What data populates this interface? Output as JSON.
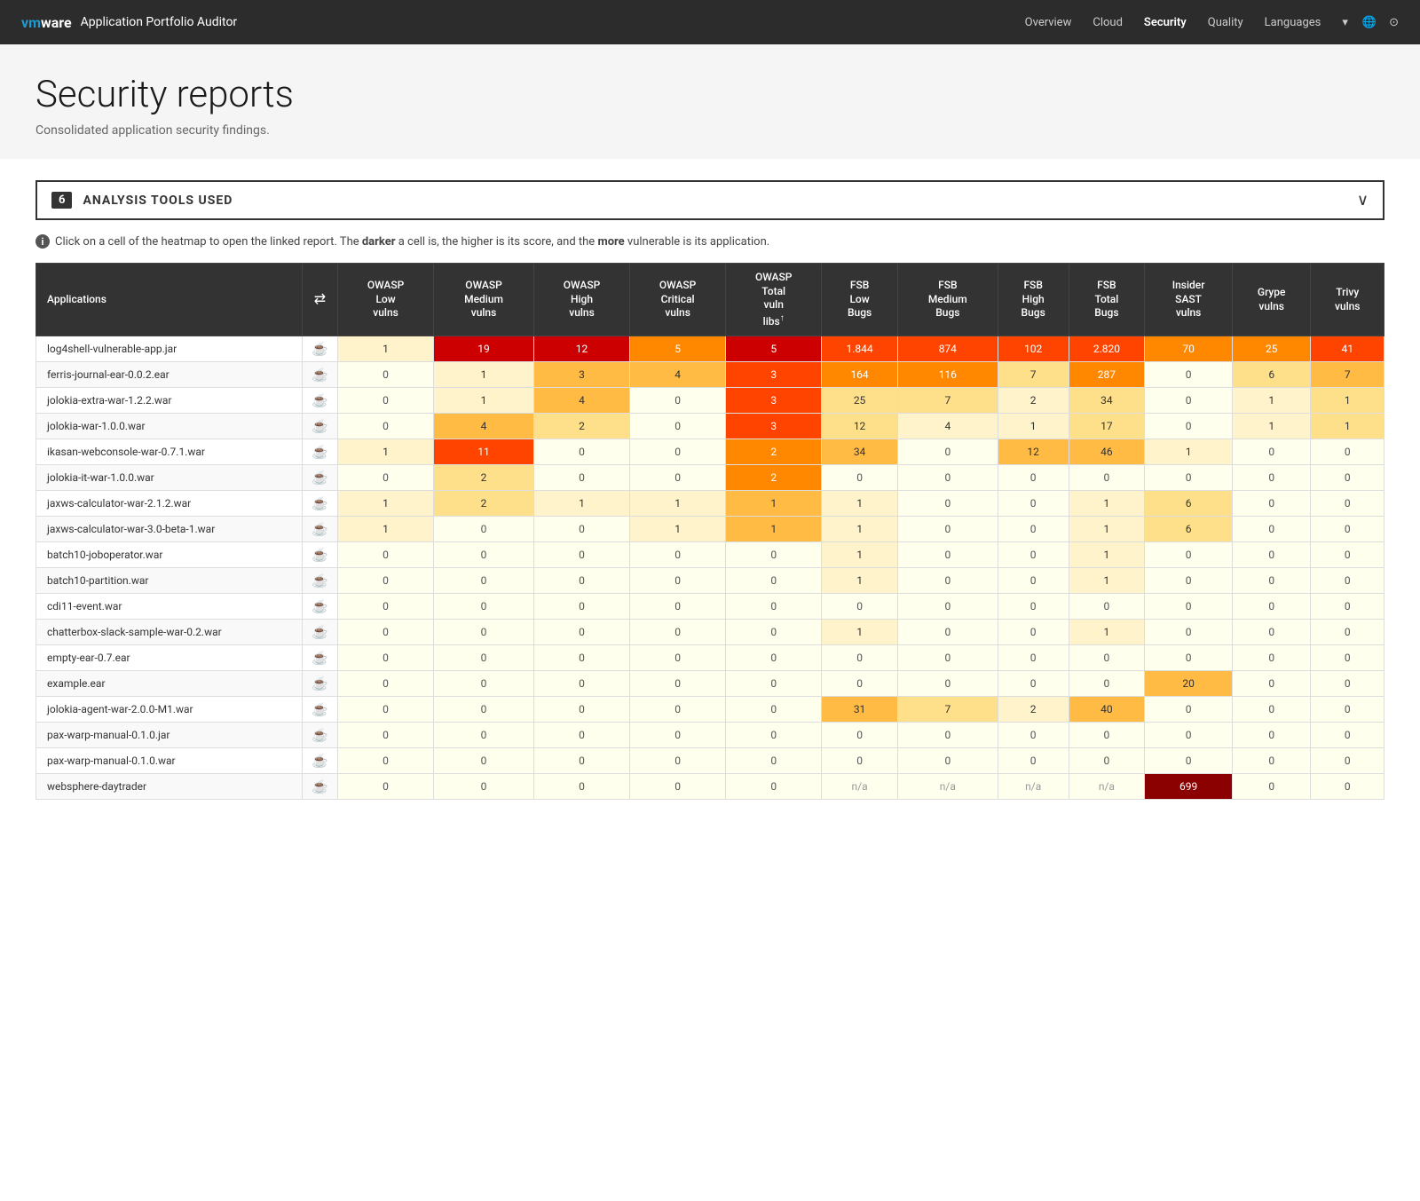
{
  "header": {
    "logo": "vm",
    "logo_colored": "ware",
    "app_name": "Application Portfolio Auditor",
    "nav": [
      {
        "label": "Overview",
        "active": false
      },
      {
        "label": "Cloud",
        "active": false
      },
      {
        "label": "Security",
        "active": true
      },
      {
        "label": "Quality",
        "active": false
      },
      {
        "label": "Languages",
        "active": false
      }
    ]
  },
  "page": {
    "title": "Security reports",
    "subtitle": "Consolidated application security findings."
  },
  "analysis_section": {
    "badge": "6",
    "label": "ANALYSIS TOOLS USED"
  },
  "info_text": "Click on a cell of the heatmap to open the linked report. The",
  "info_darker": "darker",
  "info_mid": "a cell is, the higher is its score, and the",
  "info_more": "more",
  "info_end": "vulnerable is its application.",
  "table": {
    "columns": [
      {
        "label": "Applications",
        "key": "app"
      },
      {
        "label": "",
        "key": "icon"
      },
      {
        "label": "OWASP Low vulns",
        "key": "owasp_low"
      },
      {
        "label": "OWASP Medium vulns",
        "key": "owasp_med"
      },
      {
        "label": "OWASP High vulns",
        "key": "owasp_high"
      },
      {
        "label": "OWASP Critical vulns",
        "key": "owasp_crit"
      },
      {
        "label": "OWASP Total vuln libs↑",
        "key": "owasp_total"
      },
      {
        "label": "FSB Low Bugs",
        "key": "fsb_low"
      },
      {
        "label": "FSB Medium Bugs",
        "key": "fsb_med"
      },
      {
        "label": "FSB High Bugs",
        "key": "fsb_high"
      },
      {
        "label": "FSB Total Bugs",
        "key": "fsb_total"
      },
      {
        "label": "Insider SAST vulns",
        "key": "insider"
      },
      {
        "label": "Grype vulns",
        "key": "grype"
      },
      {
        "label": "Trivy vulns",
        "key": "trivy"
      }
    ],
    "rows": [
      {
        "app": "log4shell-vulnerable-app.jar",
        "owasp_low": 1,
        "owasp_med": 19,
        "owasp_high": 12,
        "owasp_crit": 5,
        "owasp_total": 5,
        "fsb_low": "1.844",
        "fsb_med": 874,
        "fsb_high": 102,
        "fsb_total": "2.820",
        "insider": 70,
        "grype": 25,
        "trivy": 41
      },
      {
        "app": "ferris-journal-ear-0.0.2.ear",
        "owasp_low": 0,
        "owasp_med": 1,
        "owasp_high": 3,
        "owasp_crit": 4,
        "owasp_total": 3,
        "fsb_low": 164,
        "fsb_med": 116,
        "fsb_high": 7,
        "fsb_total": 287,
        "insider": 0,
        "grype": 6,
        "trivy": 7
      },
      {
        "app": "jolokia-extra-war-1.2.2.war",
        "owasp_low": 0,
        "owasp_med": 1,
        "owasp_high": 4,
        "owasp_crit": 0,
        "owasp_total": 3,
        "fsb_low": 25,
        "fsb_med": 7,
        "fsb_high": 2,
        "fsb_total": 34,
        "insider": 0,
        "grype": 1,
        "trivy": 1
      },
      {
        "app": "jolokia-war-1.0.0.war",
        "owasp_low": 0,
        "owasp_med": 4,
        "owasp_high": 2,
        "owasp_crit": 0,
        "owasp_total": 3,
        "fsb_low": 12,
        "fsb_med": 4,
        "fsb_high": 1,
        "fsb_total": 17,
        "insider": 0,
        "grype": 1,
        "trivy": 1
      },
      {
        "app": "ikasan-webconsole-war-0.7.1.war",
        "owasp_low": 1,
        "owasp_med": 11,
        "owasp_high": 0,
        "owasp_crit": 0,
        "owasp_total": 2,
        "fsb_low": 34,
        "fsb_med": 0,
        "fsb_high": 12,
        "fsb_total": 46,
        "insider": 1,
        "grype": 0,
        "trivy": 0
      },
      {
        "app": "jolokia-it-war-1.0.0.war",
        "owasp_low": 0,
        "owasp_med": 2,
        "owasp_high": 0,
        "owasp_crit": 0,
        "owasp_total": 2,
        "fsb_low": 0,
        "fsb_med": 0,
        "fsb_high": 0,
        "fsb_total": 0,
        "insider": 0,
        "grype": 0,
        "trivy": 0
      },
      {
        "app": "jaxws-calculator-war-2.1.2.war",
        "owasp_low": 1,
        "owasp_med": 2,
        "owasp_high": 1,
        "owasp_crit": 1,
        "owasp_total": 1,
        "fsb_low": 1,
        "fsb_med": 0,
        "fsb_high": 0,
        "fsb_total": 1,
        "insider": 6,
        "grype": 0,
        "trivy": 0
      },
      {
        "app": "jaxws-calculator-war-3.0-beta-1.war",
        "owasp_low": 1,
        "owasp_med": 0,
        "owasp_high": 0,
        "owasp_crit": 1,
        "owasp_total": 1,
        "fsb_low": 1,
        "fsb_med": 0,
        "fsb_high": 0,
        "fsb_total": 1,
        "insider": 6,
        "grype": 0,
        "trivy": 0
      },
      {
        "app": "batch10-joboperator.war",
        "owasp_low": 0,
        "owasp_med": 0,
        "owasp_high": 0,
        "owasp_crit": 0,
        "owasp_total": 0,
        "fsb_low": 1,
        "fsb_med": 0,
        "fsb_high": 0,
        "fsb_total": 1,
        "insider": 0,
        "grype": 0,
        "trivy": 0
      },
      {
        "app": "batch10-partition.war",
        "owasp_low": 0,
        "owasp_med": 0,
        "owasp_high": 0,
        "owasp_crit": 0,
        "owasp_total": 0,
        "fsb_low": 1,
        "fsb_med": 0,
        "fsb_high": 0,
        "fsb_total": 1,
        "insider": 0,
        "grype": 0,
        "trivy": 0
      },
      {
        "app": "cdi11-event.war",
        "owasp_low": 0,
        "owasp_med": 0,
        "owasp_high": 0,
        "owasp_crit": 0,
        "owasp_total": 0,
        "fsb_low": 0,
        "fsb_med": 0,
        "fsb_high": 0,
        "fsb_total": 0,
        "insider": 0,
        "grype": 0,
        "trivy": 0
      },
      {
        "app": "chatterbox-slack-sample-war-0.2.war",
        "owasp_low": 0,
        "owasp_med": 0,
        "owasp_high": 0,
        "owasp_crit": 0,
        "owasp_total": 0,
        "fsb_low": 1,
        "fsb_med": 0,
        "fsb_high": 0,
        "fsb_total": 1,
        "insider": 0,
        "grype": 0,
        "trivy": 0
      },
      {
        "app": "empty-ear-0.7.ear",
        "owasp_low": 0,
        "owasp_med": 0,
        "owasp_high": 0,
        "owasp_crit": 0,
        "owasp_total": 0,
        "fsb_low": 0,
        "fsb_med": 0,
        "fsb_high": 0,
        "fsb_total": 0,
        "insider": 0,
        "grype": 0,
        "trivy": 0
      },
      {
        "app": "example.ear",
        "owasp_low": 0,
        "owasp_med": 0,
        "owasp_high": 0,
        "owasp_crit": 0,
        "owasp_total": 0,
        "fsb_low": 0,
        "fsb_med": 0,
        "fsb_high": 0,
        "fsb_total": 0,
        "insider": 20,
        "grype": 0,
        "trivy": 0
      },
      {
        "app": "jolokia-agent-war-2.0.0-M1.war",
        "owasp_low": 0,
        "owasp_med": 0,
        "owasp_high": 0,
        "owasp_crit": 0,
        "owasp_total": 0,
        "fsb_low": 31,
        "fsb_med": 7,
        "fsb_high": 2,
        "fsb_total": 40,
        "insider": 0,
        "grype": 0,
        "trivy": 0
      },
      {
        "app": "pax-warp-manual-0.1.0.jar",
        "owasp_low": 0,
        "owasp_med": 0,
        "owasp_high": 0,
        "owasp_crit": 0,
        "owasp_total": 0,
        "fsb_low": 0,
        "fsb_med": 0,
        "fsb_high": 0,
        "fsb_total": 0,
        "insider": 0,
        "grype": 0,
        "trivy": 0
      },
      {
        "app": "pax-warp-manual-0.1.0.war",
        "owasp_low": 0,
        "owasp_med": 0,
        "owasp_high": 0,
        "owasp_crit": 0,
        "owasp_total": 0,
        "fsb_low": 0,
        "fsb_med": 0,
        "fsb_high": 0,
        "fsb_total": 0,
        "insider": 0,
        "grype": 0,
        "trivy": 0
      },
      {
        "app": "websphere-daytrader",
        "owasp_low": 0,
        "owasp_med": 0,
        "owasp_high": 0,
        "owasp_crit": 0,
        "owasp_total": 0,
        "fsb_low": "n/a",
        "fsb_med": "n/a",
        "fsb_high": "n/a",
        "fsb_total": "n/a",
        "insider": 699,
        "grype": 0,
        "trivy": 0
      }
    ]
  }
}
